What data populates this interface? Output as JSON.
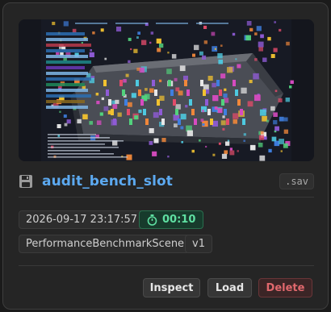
{
  "save_slot": {
    "name": "audit_bench_slot",
    "extension": ".sav",
    "timestamp": "2026-09-17 23:17:57",
    "playtime": "00:10",
    "scene": "PerformanceBenchmarkScene",
    "version": "v1"
  },
  "icons": {
    "save": "floppy-disk-icon",
    "timer": "stopwatch-icon"
  },
  "actions": {
    "inspect": "Inspect",
    "load": "Load",
    "delete": "Delete"
  },
  "colors": {
    "title": "#5ca9f0",
    "timer_text": "#5fe0a2",
    "timer_bg": "#173b2c",
    "delete_text": "#e0686d"
  }
}
